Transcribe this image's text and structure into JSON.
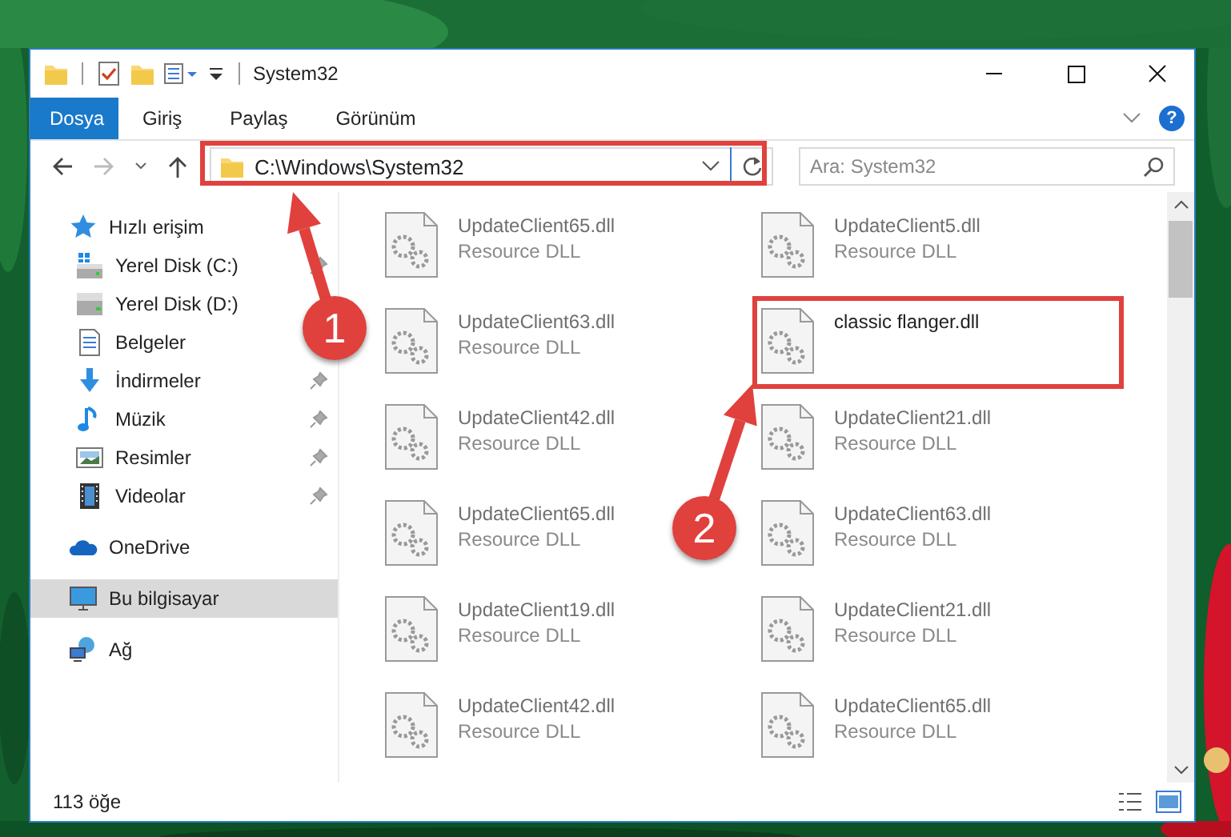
{
  "window": {
    "title": "System32"
  },
  "ribbon": {
    "tabs": [
      {
        "label": "Dosya",
        "selected": true
      },
      {
        "label": "Giriş",
        "selected": false
      },
      {
        "label": "Paylaş",
        "selected": false
      },
      {
        "label": "Görünüm",
        "selected": false
      }
    ],
    "help": "?"
  },
  "address_bar": {
    "path": "C:\\Windows\\System32"
  },
  "search": {
    "placeholder": "Ara: System32"
  },
  "sidebar": {
    "items": [
      {
        "label": "Hızlı erişim",
        "kind": "star",
        "selected": false,
        "children": [
          {
            "label": "Yerel Disk (C:)",
            "kind": "drive-c",
            "pinned": true,
            "selected": false
          },
          {
            "label": "Yerel Disk (D:)",
            "kind": "drive",
            "pinned": false,
            "selected": false
          },
          {
            "label": "Belgeler",
            "kind": "docs",
            "pinned": false,
            "selected": false
          },
          {
            "label": "İndirmeler",
            "kind": "download",
            "pinned": true,
            "selected": false
          },
          {
            "label": "Müzik",
            "kind": "music",
            "pinned": true,
            "selected": false
          },
          {
            "label": "Resimler",
            "kind": "pictures",
            "pinned": true,
            "selected": false
          },
          {
            "label": "Videolar",
            "kind": "videos",
            "pinned": true,
            "selected": false
          }
        ]
      },
      {
        "label": "OneDrive",
        "kind": "cloud",
        "selected": false
      },
      {
        "label": "Bu bilgisayar",
        "kind": "computer",
        "selected": true
      },
      {
        "label": "Ağ",
        "kind": "network",
        "selected": false
      }
    ]
  },
  "files": [
    {
      "name": "UpdateClient65.dll",
      "type": "Resource DLL",
      "faded": true
    },
    {
      "name": "UpdateClient5.dll",
      "type": "Resource DLL",
      "faded": true
    },
    {
      "name": "UpdateClient63.dll",
      "type": "Resource DLL",
      "faded": true
    },
    {
      "name": "classic flanger.dll",
      "faded": false
    },
    {
      "name": "UpdateClient42.dll",
      "type": "Resource DLL",
      "faded": true
    },
    {
      "name": "UpdateClient21.dll",
      "type": "Resource DLL",
      "faded": true
    },
    {
      "name": "UpdateClient65.dll",
      "type": "Resource DLL",
      "faded": true
    },
    {
      "name": "UpdateClient63.dll",
      "type": "Resource DLL",
      "faded": true
    },
    {
      "name": "UpdateClient19.dll",
      "type": "Resource DLL",
      "faded": true
    },
    {
      "name": "UpdateClient21.dll",
      "type": "Resource DLL",
      "faded": true
    },
    {
      "name": "UpdateClient42.dll",
      "type": "Resource DLL",
      "faded": true
    },
    {
      "name": "UpdateClient65.dll",
      "type": "Resource DLL",
      "faded": true
    }
  ],
  "status_bar": {
    "item_count": "113 öğe"
  },
  "annotations": [
    {
      "label": "1"
    },
    {
      "label": "2"
    }
  ]
}
